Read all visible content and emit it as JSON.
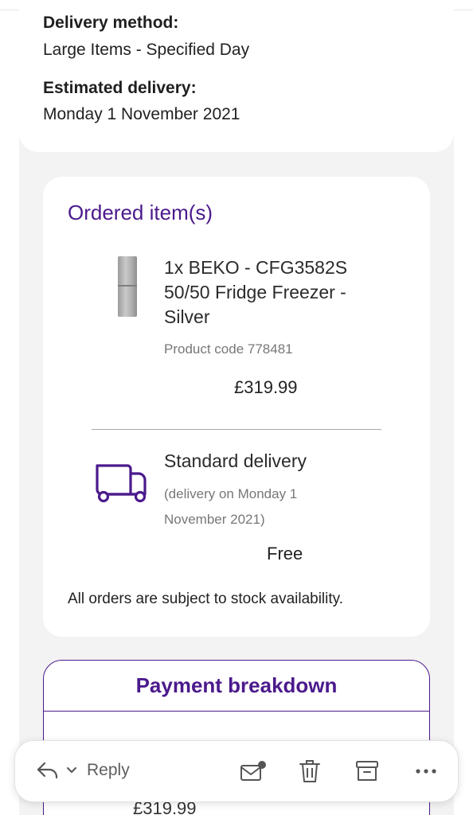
{
  "delivery": {
    "method_label": "Delivery method:",
    "method_value": "Large Items - Specified Day",
    "estimate_label": "Estimated delivery:",
    "estimate_value": "Monday 1 November 2021"
  },
  "items": {
    "title": "Ordered item(s)",
    "product": {
      "name": "1x BEKO - CFG3582S 50/50 Fridge Freezer - Silver",
      "code": "Product code 778481",
      "price": "£319.99"
    },
    "shipping": {
      "title": "Standard delivery",
      "detail": "(delivery on Monday 1 November 2021)",
      "cost": "Free"
    },
    "note": "All orders are subject to stock availability."
  },
  "payment": {
    "title": "Payment breakdown",
    "first_amount": "£319.99"
  },
  "toolbar": {
    "reply_label": "Reply",
    "icons": [
      "reply-icon",
      "chevron-down-icon",
      "mark-unread-icon",
      "trash-icon",
      "archive-icon",
      "more-icon"
    ]
  },
  "colors": {
    "accent": "#4b1a8c",
    "panel": "#f3f3f3"
  }
}
